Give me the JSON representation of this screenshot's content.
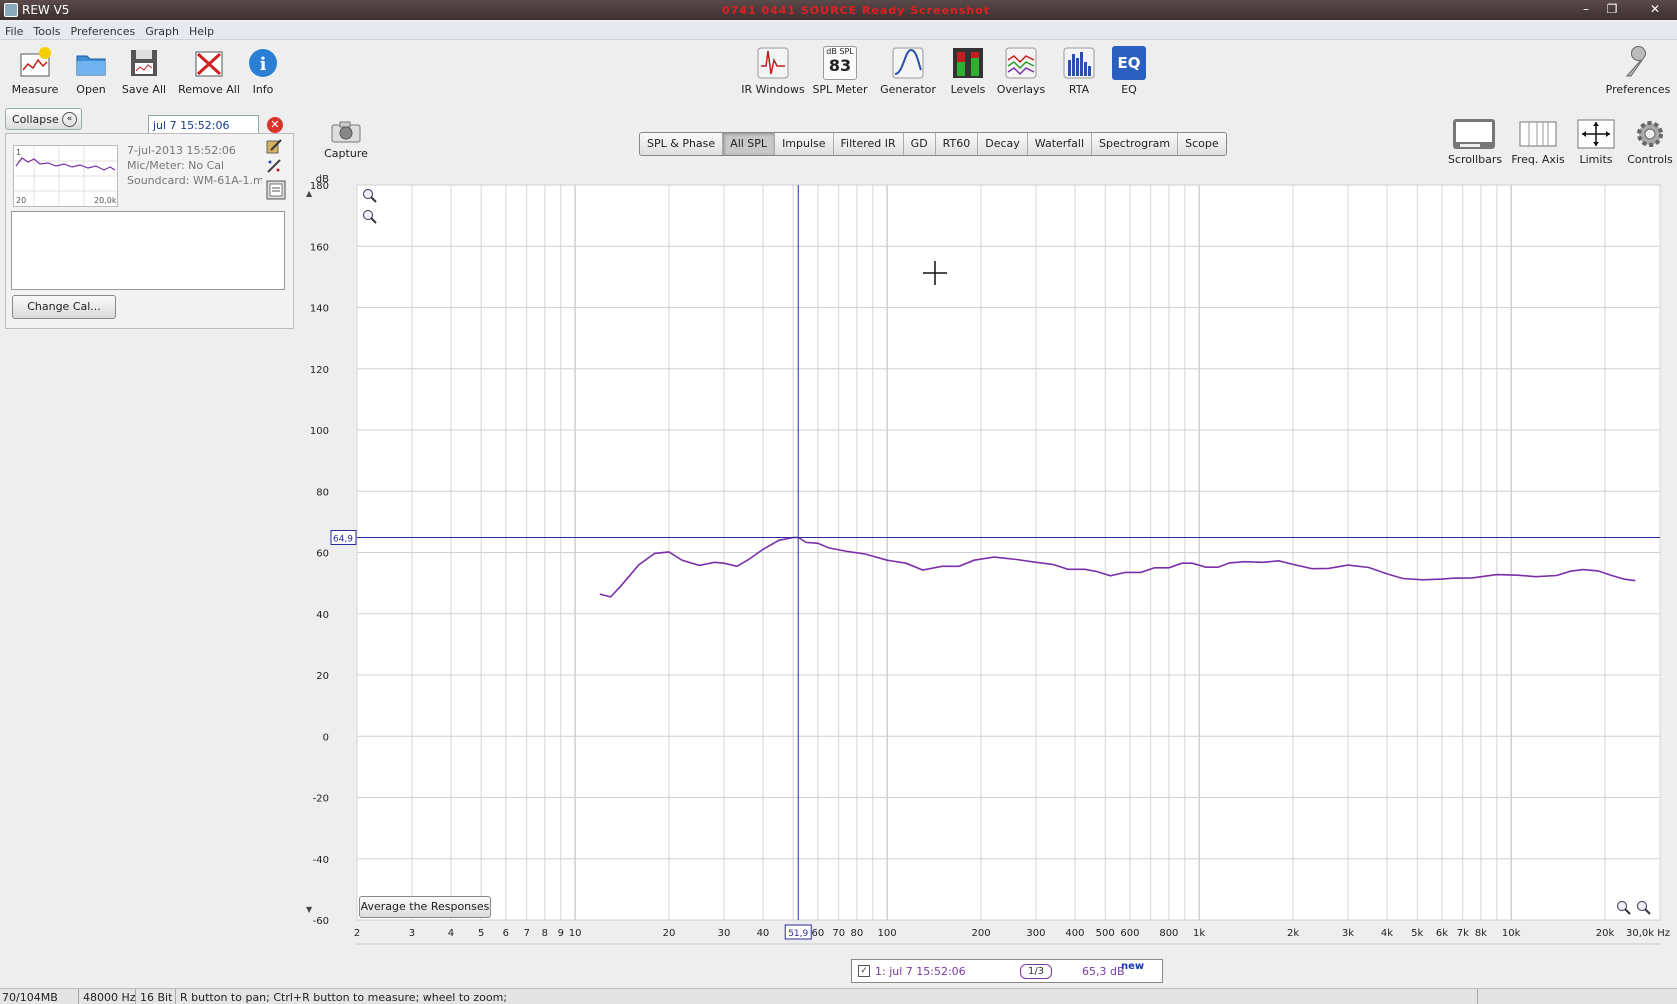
{
  "window": {
    "title": "REW V5",
    "banner_text": "0741 0441 SOURCE Ready Screenshot",
    "minimize_icon": "minimize-icon",
    "maximize_icon": "restore-icon",
    "close_icon": "close-icon"
  },
  "menu": [
    "File",
    "Tools",
    "Preferences",
    "Graph",
    "Help"
  ],
  "toolbar_left": [
    {
      "label": "Measure",
      "icon": "measure-icon"
    },
    {
      "label": "Open",
      "icon": "folder-icon"
    },
    {
      "label": "Save All",
      "icon": "save-icon"
    },
    {
      "label": "Remove All",
      "icon": "remove-icon"
    },
    {
      "label": "Info",
      "icon": "info-icon"
    }
  ],
  "toolbar_center": [
    {
      "label": "IR Windows",
      "icon": "ir-windows-icon"
    },
    {
      "label": "SPL Meter",
      "icon": "spl-meter-icon",
      "icon_top": "dB SPL",
      "icon_value": "83"
    },
    {
      "label": "Generator",
      "icon": "generator-icon"
    },
    {
      "label": "Levels",
      "icon": "levels-icon"
    },
    {
      "label": "Overlays",
      "icon": "overlays-icon"
    },
    {
      "label": "RTA",
      "icon": "rta-icon"
    },
    {
      "label": "EQ",
      "icon": "eq-icon",
      "icon_text": "EQ"
    }
  ],
  "toolbar_right": {
    "label": "Preferences",
    "icon": "wrench-icon"
  },
  "graph_tools": [
    {
      "label": "Scrollbars",
      "icon": "scrollbars-icon"
    },
    {
      "label": "Freq. Axis",
      "icon": "freq-axis-icon"
    },
    {
      "label": "Limits",
      "icon": "limits-icon"
    },
    {
      "label": "Controls",
      "icon": "controls-gear-icon"
    }
  ],
  "capture": {
    "label": "Capture",
    "icon": "camera-icon"
  },
  "left_panel": {
    "collapse_label": "Collapse",
    "measurement_name": "jul 7 15:52:06",
    "thumb_index": "1",
    "thumb_x_start": "20",
    "thumb_x_end": "20,0k",
    "info_lines": [
      "7-jul-2013 15:52:06",
      "Mic/Meter: No Cal",
      "Soundcard: WM-61A-1.mic"
    ],
    "change_cal_label": "Change Cal..."
  },
  "tabs": [
    {
      "label": "SPL & Phase",
      "active": false
    },
    {
      "label": "All SPL",
      "active": true
    },
    {
      "label": "Impulse",
      "active": false
    },
    {
      "label": "Filtered IR",
      "active": false
    },
    {
      "label": "GD",
      "active": false
    },
    {
      "label": "RT60",
      "active": false
    },
    {
      "label": "Decay",
      "active": false
    },
    {
      "label": "Waterfall",
      "active": false
    },
    {
      "label": "Spectrogram",
      "active": false
    },
    {
      "label": "Scope",
      "active": false
    }
  ],
  "chart_data": {
    "type": "line",
    "ylabel": "dB",
    "xlabel": "Hz",
    "x_scale": "log",
    "xlim": [
      2,
      30000
    ],
    "ylim": [
      -60,
      180
    ],
    "grid": true,
    "y_ticks": [
      180,
      160,
      140,
      120,
      100,
      80,
      60,
      40,
      20,
      0,
      -20,
      -40,
      -60
    ],
    "x_tick_labels": [
      {
        "v": 2,
        "t": "2"
      },
      {
        "v": 3,
        "t": "3"
      },
      {
        "v": 4,
        "t": "4"
      },
      {
        "v": 5,
        "t": "5"
      },
      {
        "v": 6,
        "t": "6"
      },
      {
        "v": 7,
        "t": "7"
      },
      {
        "v": 8,
        "t": "8"
      },
      {
        "v": 9,
        "t": "9"
      },
      {
        "v": 10,
        "t": "10"
      },
      {
        "v": 20,
        "t": "20"
      },
      {
        "v": 30,
        "t": "30"
      },
      {
        "v": 40,
        "t": "40"
      },
      {
        "v": 60,
        "t": "60"
      },
      {
        "v": 70,
        "t": "70"
      },
      {
        "v": 80,
        "t": "80"
      },
      {
        "v": 100,
        "t": "100"
      },
      {
        "v": 200,
        "t": "200"
      },
      {
        "v": 300,
        "t": "300"
      },
      {
        "v": 400,
        "t": "400"
      },
      {
        "v": 500,
        "t": "500"
      },
      {
        "v": 600,
        "t": "600"
      },
      {
        "v": 800,
        "t": "800"
      },
      {
        "v": 1000,
        "t": "1k"
      },
      {
        "v": 2000,
        "t": "2k"
      },
      {
        "v": 3000,
        "t": "3k"
      },
      {
        "v": 4000,
        "t": "4k"
      },
      {
        "v": 5000,
        "t": "5k"
      },
      {
        "v": 6000,
        "t": "6k"
      },
      {
        "v": 7000,
        "t": "7k"
      },
      {
        "v": 8000,
        "t": "8k"
      },
      {
        "v": 10000,
        "t": "10k"
      },
      {
        "v": 20000,
        "t": "20k"
      },
      {
        "v": 30000,
        "t": "30,0k Hz"
      }
    ],
    "cursor": {
      "x": 51.9,
      "y": 64.9,
      "x_label": "51,9",
      "y_label": "64,9"
    },
    "series": [
      {
        "color": "#7a2fa8",
        "points": [
          [
            12,
            46.4
          ],
          [
            13,
            45.5
          ],
          [
            14,
            49
          ],
          [
            16,
            56
          ],
          [
            18,
            59.7
          ],
          [
            20,
            60.2
          ],
          [
            22,
            57.5
          ],
          [
            25,
            55.8
          ],
          [
            28,
            56.8
          ],
          [
            30,
            56.5
          ],
          [
            33,
            55.5
          ],
          [
            36,
            57.7
          ],
          [
            40,
            61
          ],
          [
            45,
            64
          ],
          [
            50,
            64.9
          ],
          [
            52,
            64.9
          ],
          [
            55,
            63.3
          ],
          [
            60,
            63
          ],
          [
            65,
            61.5
          ],
          [
            75,
            60.3
          ],
          [
            85,
            59.5
          ],
          [
            100,
            57.5
          ],
          [
            115,
            56.5
          ],
          [
            130,
            54.3
          ],
          [
            150,
            55.5
          ],
          [
            170,
            55.5
          ],
          [
            190,
            57.5
          ],
          [
            220,
            58.5
          ],
          [
            260,
            57.7
          ],
          [
            300,
            56.8
          ],
          [
            340,
            56.1
          ],
          [
            380,
            54.5
          ],
          [
            430,
            54.5
          ],
          [
            470,
            53.8
          ],
          [
            520,
            52.4
          ],
          [
            580,
            53.5
          ],
          [
            650,
            53.5
          ],
          [
            720,
            55
          ],
          [
            800,
            55
          ],
          [
            880,
            56.5
          ],
          [
            950,
            56.5
          ],
          [
            1050,
            55.2
          ],
          [
            1150,
            55.2
          ],
          [
            1250,
            56.6
          ],
          [
            1400,
            57
          ],
          [
            1600,
            56.8
          ],
          [
            1800,
            57.3
          ],
          [
            2000,
            56.1
          ],
          [
            2300,
            54.7
          ],
          [
            2600,
            54.8
          ],
          [
            3000,
            55.9
          ],
          [
            3500,
            55.1
          ],
          [
            4000,
            53
          ],
          [
            4500,
            51.5
          ],
          [
            5200,
            51.1
          ],
          [
            6000,
            51.3
          ],
          [
            6500,
            51.6
          ],
          [
            7500,
            51.7
          ],
          [
            9000,
            52.8
          ],
          [
            10500,
            52.6
          ],
          [
            12000,
            52.1
          ],
          [
            14000,
            52.5
          ],
          [
            15500,
            53.9
          ],
          [
            17000,
            54.4
          ],
          [
            19000,
            54
          ],
          [
            21000,
            52.5
          ],
          [
            23000,
            51.3
          ],
          [
            25000,
            50.8
          ]
        ]
      }
    ]
  },
  "average_button": "Average the Responses",
  "legend": {
    "checked": "✓",
    "name": "1: jul 7 15:52:06",
    "smoothing": "1/3",
    "level": "65,3 dB",
    "badge": "new"
  },
  "status": {
    "memory": "70/104MB",
    "rate": "48000 Hz",
    "bits": "16 Bit",
    "hint": "R button to pan; Ctrl+R button to measure; wheel to zoom;"
  },
  "colors": {
    "trace": "#7a2fa8",
    "cursor": "#2a2aa0",
    "grid": "#c8c8c8",
    "accent_red": "#d9342a"
  }
}
